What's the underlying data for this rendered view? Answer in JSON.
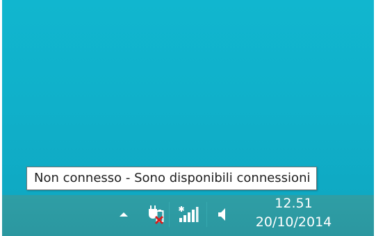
{
  "tooltip": {
    "text": "Non connesso - Sono disponibili connessioni"
  },
  "tray": {
    "icons": [
      "show-hidden-icons-chevron-icon",
      "power-unplugged-icon",
      "wireless-network-icon",
      "volume-icon"
    ],
    "clock_time": "12.51",
    "clock_date": "20/10/2014"
  },
  "colors": {
    "desktop": "#11b6cf",
    "taskbar": "#2f9ea5",
    "tooltip_bg": "#ffffff"
  }
}
